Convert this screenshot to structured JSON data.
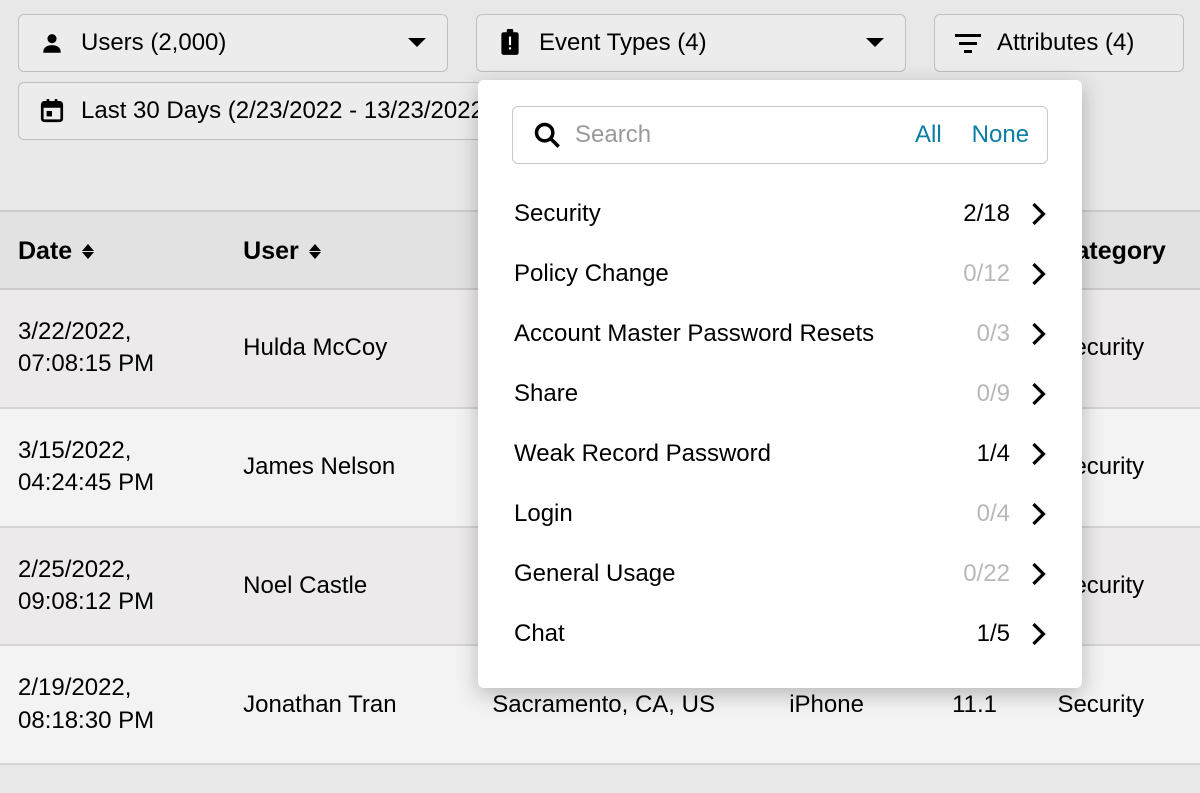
{
  "filters": {
    "users": "Users (2,000)",
    "event_types": "Event Types (4)",
    "attributes": "Attributes (4)",
    "date_range": "Last 30 Days (2/23/2022 - 13/23/2022)"
  },
  "dropdown": {
    "search_placeholder": "Search",
    "all": "All",
    "none": "None",
    "items": [
      {
        "name": "Security",
        "count": "2/18",
        "active": true
      },
      {
        "name": "Policy Change",
        "count": "0/12",
        "active": false
      },
      {
        "name": "Account Master Password Resets",
        "count": "0/3",
        "active": false
      },
      {
        "name": "Share",
        "count": "0/9",
        "active": false
      },
      {
        "name": "Weak Record Password",
        "count": "1/4",
        "active": true
      },
      {
        "name": "Login",
        "count": "0/4",
        "active": false
      },
      {
        "name": "General Usage",
        "count": "0/22",
        "active": false
      },
      {
        "name": "Chat",
        "count": "1/5",
        "active": true
      }
    ]
  },
  "table": {
    "headers": {
      "date": "Date",
      "user": "User",
      "category": "Category"
    },
    "rows": [
      {
        "date1": "3/22/2022,",
        "date2": "07:08:15 PM",
        "user": "Hulda McCoy",
        "loc": "",
        "dev": "",
        "ver": "",
        "cat": "Security"
      },
      {
        "date1": "3/15/2022,",
        "date2": "04:24:45 PM",
        "user": "James Nelson",
        "loc": "",
        "dev": "",
        "ver": "",
        "cat": "Security"
      },
      {
        "date1": "2/25/2022,",
        "date2": "09:08:12 PM",
        "user": "Noel Castle",
        "loc": "",
        "dev": "",
        "ver": "",
        "cat": "Security"
      },
      {
        "date1": "2/19/2022,",
        "date2": "08:18:30 PM",
        "user": "Jonathan Tran",
        "loc": "Sacramento, CA, US",
        "dev": "iPhone",
        "ver": "11.1",
        "cat": "Security"
      }
    ]
  }
}
